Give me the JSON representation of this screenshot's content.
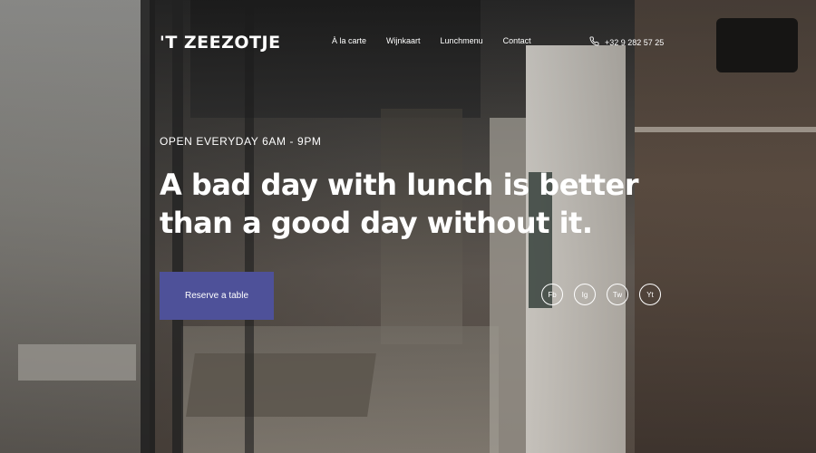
{
  "header": {
    "logo_text": "'T ZEEZOTJE",
    "nav": [
      {
        "label": "À la carte"
      },
      {
        "label": "Wijnkaart"
      },
      {
        "label": "Lunchmenu"
      },
      {
        "label": "Contact"
      }
    ],
    "phone": "+32 9 282 57 25",
    "phone_icon": "phone-icon"
  },
  "hero": {
    "eyebrow": "OPEN EVERYDAY  6AM - 9PM",
    "headline": "A bad day with lunch is better than a good day without it.",
    "cta_label": "Reserve a table"
  },
  "socials": [
    {
      "label": "Fb"
    },
    {
      "label": "Ig"
    },
    {
      "label": "Tw"
    },
    {
      "label": "Yt"
    }
  ],
  "colors": {
    "accent": "#4e5199",
    "text": "#ffffff"
  }
}
